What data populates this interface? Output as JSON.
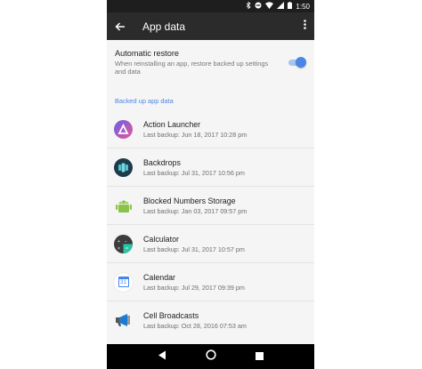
{
  "status_bar": {
    "time": "1:50",
    "icons": [
      "bluetooth-icon",
      "dnd-icon",
      "wifi-icon",
      "signal-icon",
      "battery-icon"
    ]
  },
  "toolbar": {
    "title": "App data",
    "back_icon": "arrow-left-icon",
    "more_icon": "more-vert-icon"
  },
  "restore": {
    "title": "Automatic restore",
    "subtitle": "When reinstalling an app, restore backed up settings and data",
    "enabled": true
  },
  "section_header": "Backed up app data",
  "apps": [
    {
      "name": "Action Launcher",
      "backup": "Last backup: Jun 18, 2017 10:28 pm",
      "icon": "action-launcher-icon"
    },
    {
      "name": "Backdrops",
      "backup": "Last backup: Jul 31, 2017 10:56 pm",
      "icon": "backdrops-icon"
    },
    {
      "name": "Blocked Numbers Storage",
      "backup": "Last backup: Jan 03, 2017 09:57 pm",
      "icon": "android-icon"
    },
    {
      "name": "Calculator",
      "backup": "Last backup: Jul 31, 2017 10:57 pm",
      "icon": "calculator-icon"
    },
    {
      "name": "Calendar",
      "backup": "Last backup: Jul 29, 2017 09:39 pm",
      "icon": "calendar-icon"
    },
    {
      "name": "Cell Broadcasts",
      "backup": "Last backup: Oct 28, 2016 07:53 am",
      "icon": "megaphone-icon"
    }
  ],
  "calendar_icon_day": "31",
  "colors": {
    "accent": "#4a86e8",
    "toolbar": "#2b2b2b",
    "status_bar": "#1e1e1e"
  },
  "nav": [
    "back-triangle-icon",
    "home-circle-icon",
    "recents-square-icon"
  ]
}
